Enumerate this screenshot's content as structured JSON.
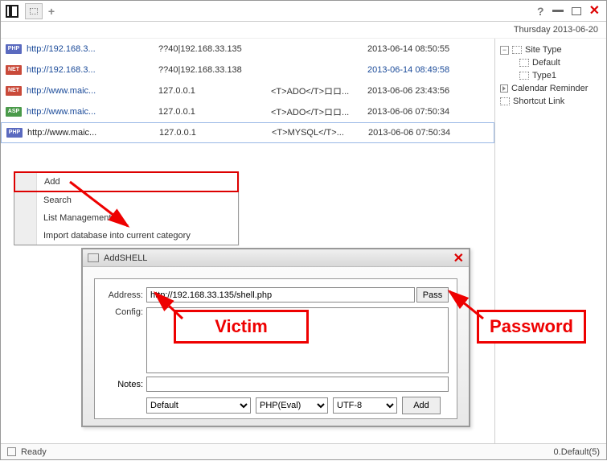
{
  "date_header": "Thursday 2013-06-20",
  "rows": [
    {
      "badge": "PHP",
      "badge_cls": "php",
      "url": "http://192.168.3...",
      "url_cls": "",
      "ip": "??40|192.168.33.135",
      "meta": "",
      "time": "2013-06-14 08:50:55",
      "time_cls": ""
    },
    {
      "badge": "NET",
      "badge_cls": "net",
      "url": "http://192.168.3...",
      "url_cls": "",
      "ip": "??40|192.168.33.138",
      "meta": "",
      "time": "2013-06-14 08:49:58",
      "time_cls": "blue"
    },
    {
      "badge": "NET",
      "badge_cls": "net",
      "url": "http://www.maic...",
      "url_cls": "",
      "ip": "127.0.0.1",
      "meta": "<T>ADO</T>ロロ...",
      "time": "2013-06-06 23:43:56",
      "time_cls": ""
    },
    {
      "badge": "ASP",
      "badge_cls": "asp",
      "url": "http://www.maic...",
      "url_cls": "",
      "ip": "127.0.0.1",
      "meta": "<T>ADO</T>ロロ...",
      "time": "2013-06-06 07:50:34",
      "time_cls": ""
    },
    {
      "badge": "PHP",
      "badge_cls": "php",
      "url": "http://www.maic...",
      "url_cls": "black",
      "ip": "127.0.0.1",
      "meta": "<T>MYSQL</T>...",
      "time": "2013-06-06 07:50:34",
      "time_cls": "",
      "selected": true
    }
  ],
  "tree": {
    "root": "Site Type",
    "children": [
      "Default",
      "Type1"
    ],
    "calendar": "Calendar Reminder",
    "shortcut": "Shortcut Link"
  },
  "ctx": {
    "add": "Add",
    "search": "Search",
    "list": "List Management",
    "import": "Import database into current category"
  },
  "shell": {
    "title": "AddSHELL",
    "address_label": "Address:",
    "address_value": "http://192.168.33.135/shell.php",
    "pass_btn": "Pass",
    "config_label": "Config:",
    "config_value": "",
    "notes_label": "Notes:",
    "notes_value": "",
    "sel1": "Default",
    "sel2": "PHP(Eval)",
    "sel3": "UTF-8",
    "add_btn": "Add"
  },
  "annotations": {
    "victim": "Victim",
    "password": "Password"
  },
  "status": {
    "ready": "Ready",
    "right": "0.Default(5)"
  }
}
